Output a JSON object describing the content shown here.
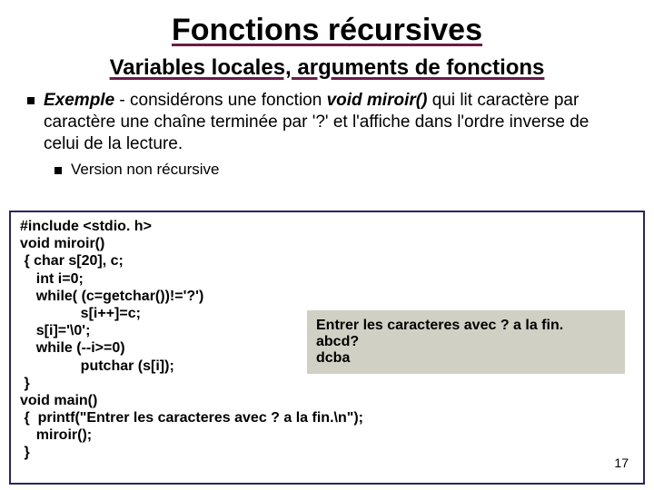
{
  "title": "Fonctions récursives",
  "subtitle": "Variables locales, arguments de fonctions",
  "exemple_label": "Exemple",
  "exemple_text_1": " - considérons une fonction ",
  "func": "void miroir()",
  "exemple_text_2": " qui lit caractère par caractère une chaîne terminée par '?' et l'affiche dans l'ordre inverse de celui de la lecture.",
  "sub_bullet": "Version non récursive",
  "code": "#include <stdio. h>\nvoid miroir()\n { char s[20], c;\n    int i=0;\n    while( (c=getchar())!='?')\n               s[i++]=c;\n    s[i]='\\0';\n    while (--i>=0)\n               putchar (s[i]);\n }\nvoid main()\n {  printf(\"Entrer les caracteres avec ? a la fin.\\n\");\n    miroir();\n }",
  "output": "Entrer les caracteres avec ? a la fin.\nabcd?\ndcba",
  "page_number": "17"
}
